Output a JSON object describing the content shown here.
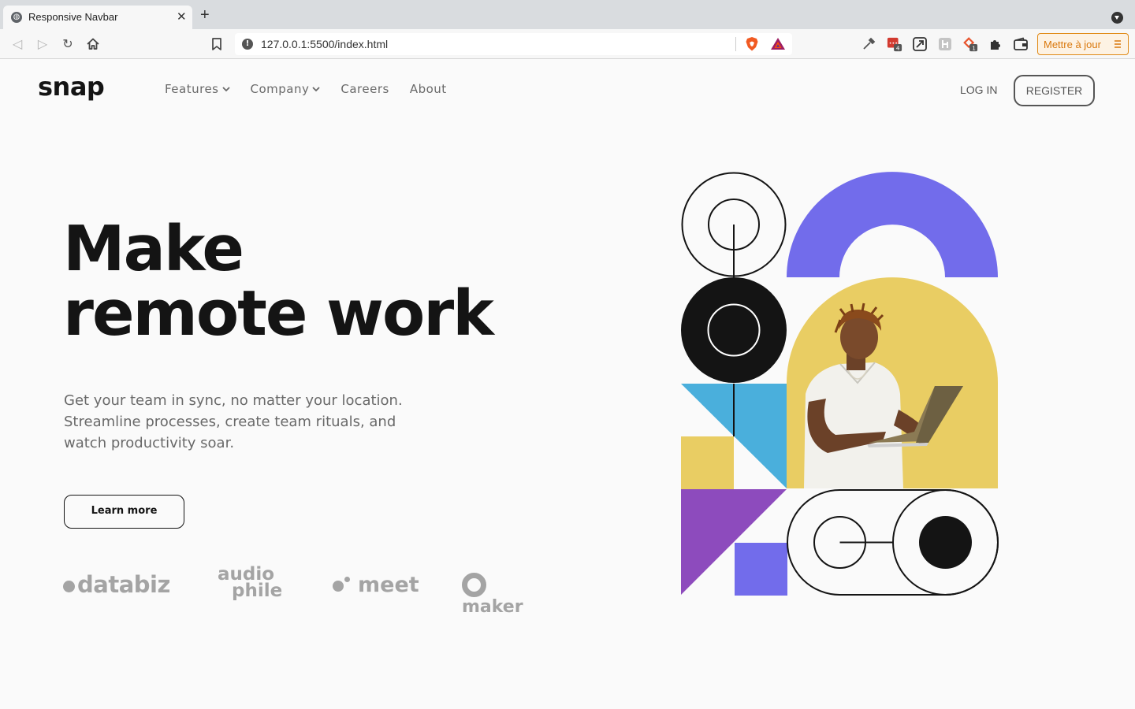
{
  "browser": {
    "tab_title": "Responsive Navbar",
    "url": "127.0.0.1:5500/index.html",
    "update_button_label": "Mettre à jour",
    "extension_badges": [
      "4",
      "1"
    ],
    "icons": [
      "globe-icon",
      "close-icon",
      "plus-icon",
      "back-icon",
      "forward-icon",
      "reload-icon",
      "home-icon",
      "bookmark-icon",
      "info-icon",
      "brave-shield-icon",
      "bat-rewards-icon",
      "eyedropper-icon",
      "extension-icon",
      "wallet-icon",
      "menu-icon"
    ]
  },
  "site": {
    "logo": "snap",
    "nav": {
      "features": "Features",
      "company": "Company",
      "careers": "Careers",
      "about": "About"
    },
    "login": "LOG IN",
    "register": "REGISTER"
  },
  "hero": {
    "title_line1": "Make",
    "title_line2": "remote work",
    "text": "Get your team in sync, no matter your location. Streamline processes, create team rituals, and watch productivity soar.",
    "button": "Learn more"
  },
  "clients": {
    "databiz": "databiz",
    "audiophile_top": "audio",
    "audiophile_bottom": "phile",
    "meet": "meet",
    "maker": "maker"
  },
  "colors": {
    "accent_purple": "#726ceb",
    "yellow": "#e9cd63",
    "cyan": "#4aafdc",
    "violet": "#8d4bbd",
    "dark": "#141414",
    "text_grey": "#696969"
  }
}
